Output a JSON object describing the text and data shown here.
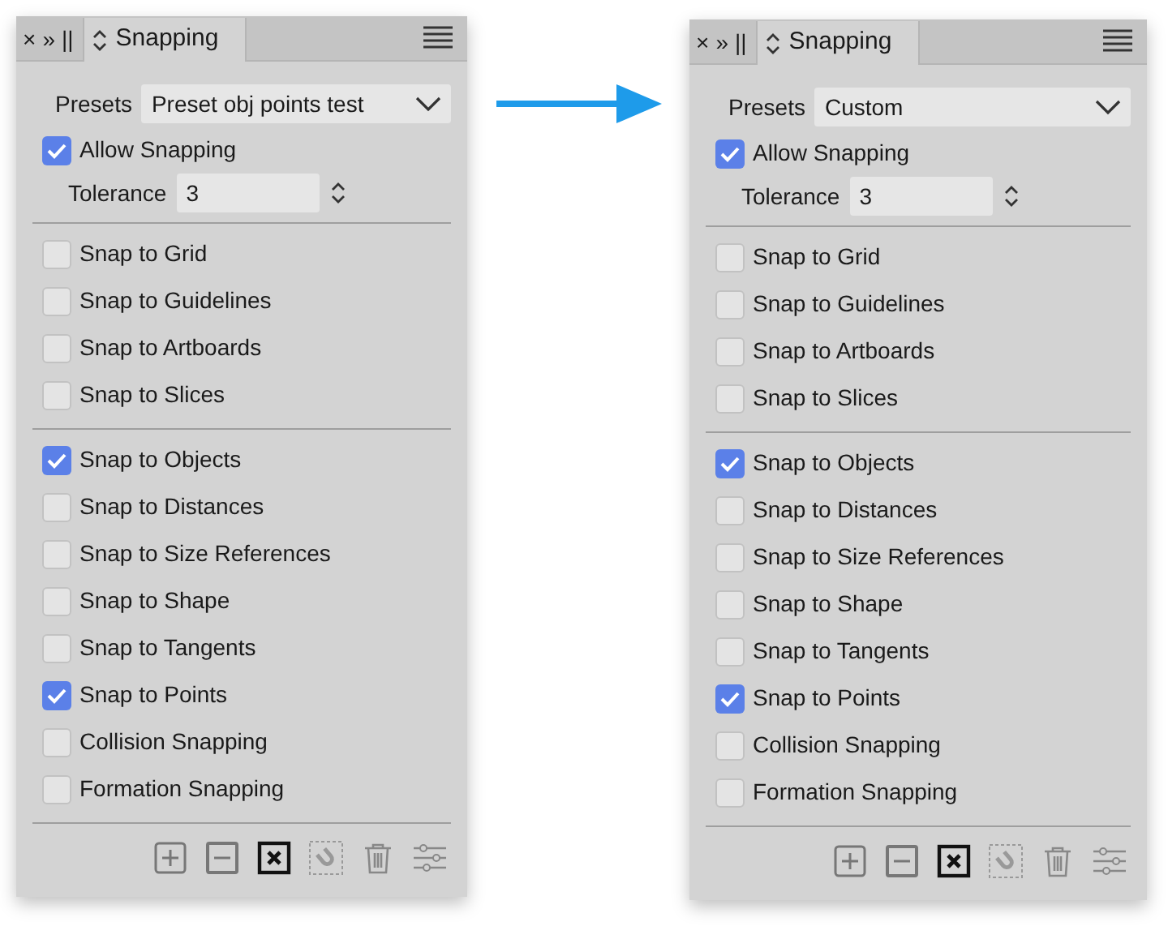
{
  "panels": [
    {
      "close": "×",
      "collapse": "»",
      "grip": "||",
      "tab_title": "Snapping",
      "presets_label": "Presets",
      "presets_value": "Preset obj points test",
      "allow_snapping": {
        "label": "Allow Snapping",
        "checked": true
      },
      "tolerance_label": "Tolerance",
      "tolerance_value": "3",
      "groups": [
        [
          {
            "label": "Snap to Grid",
            "checked": false
          },
          {
            "label": "Snap to Guidelines",
            "checked": false
          },
          {
            "label": "Snap to Artboards",
            "checked": false
          },
          {
            "label": "Snap to Slices",
            "checked": false
          }
        ],
        [
          {
            "label": "Snap to Objects",
            "checked": true
          },
          {
            "label": "Snap to Distances",
            "checked": false
          },
          {
            "label": "Snap to Size References",
            "checked": false
          },
          {
            "label": "Snap to Shape",
            "checked": false
          },
          {
            "label": "Snap to Tangents",
            "checked": false
          },
          {
            "label": "Snap to Points",
            "checked": true
          },
          {
            "label": "Collision Snapping",
            "checked": false
          },
          {
            "label": "Formation Snapping",
            "checked": false
          }
        ]
      ]
    },
    {
      "close": "×",
      "collapse": "»",
      "grip": "||",
      "tab_title": "Snapping",
      "presets_label": "Presets",
      "presets_value": "Custom",
      "allow_snapping": {
        "label": "Allow Snapping",
        "checked": true
      },
      "tolerance_label": "Tolerance",
      "tolerance_value": "3",
      "groups": [
        [
          {
            "label": "Snap to Grid",
            "checked": false
          },
          {
            "label": "Snap to Guidelines",
            "checked": false
          },
          {
            "label": "Snap to Artboards",
            "checked": false
          },
          {
            "label": "Snap to Slices",
            "checked": false
          }
        ],
        [
          {
            "label": "Snap to Objects",
            "checked": true
          },
          {
            "label": "Snap to Distances",
            "checked": false
          },
          {
            "label": "Snap to Size References",
            "checked": false
          },
          {
            "label": "Snap to Shape",
            "checked": false
          },
          {
            "label": "Snap to Tangents",
            "checked": false
          },
          {
            "label": "Snap to Points",
            "checked": true
          },
          {
            "label": "Collision Snapping",
            "checked": false
          },
          {
            "label": "Formation Snapping",
            "checked": false
          }
        ]
      ]
    }
  ]
}
